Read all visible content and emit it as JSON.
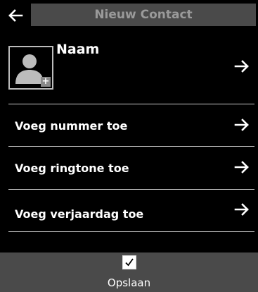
{
  "header": {
    "title": "Nieuw Contact",
    "back_icon": "arrow-left-icon"
  },
  "name_row": {
    "label": "Naam",
    "avatar_icon": "person-add-icon",
    "avatar_badge": "+",
    "arrow_icon": "arrow-right-icon"
  },
  "menu": {
    "items": [
      {
        "label": "Voeg nummer toe",
        "icon": "arrow-right-icon"
      },
      {
        "label": "Voeg ringtone toe",
        "icon": "arrow-right-icon"
      },
      {
        "label": "Voeg verjaardag toe",
        "icon": "arrow-right-icon"
      }
    ]
  },
  "footer": {
    "save_label": "Opslaan",
    "check_icon": "checkmark-icon"
  },
  "colors": {
    "background": "#000000",
    "bar": "#4a4a4a",
    "title_text": "#9a9a9a",
    "divider": "#c8c8c8"
  }
}
